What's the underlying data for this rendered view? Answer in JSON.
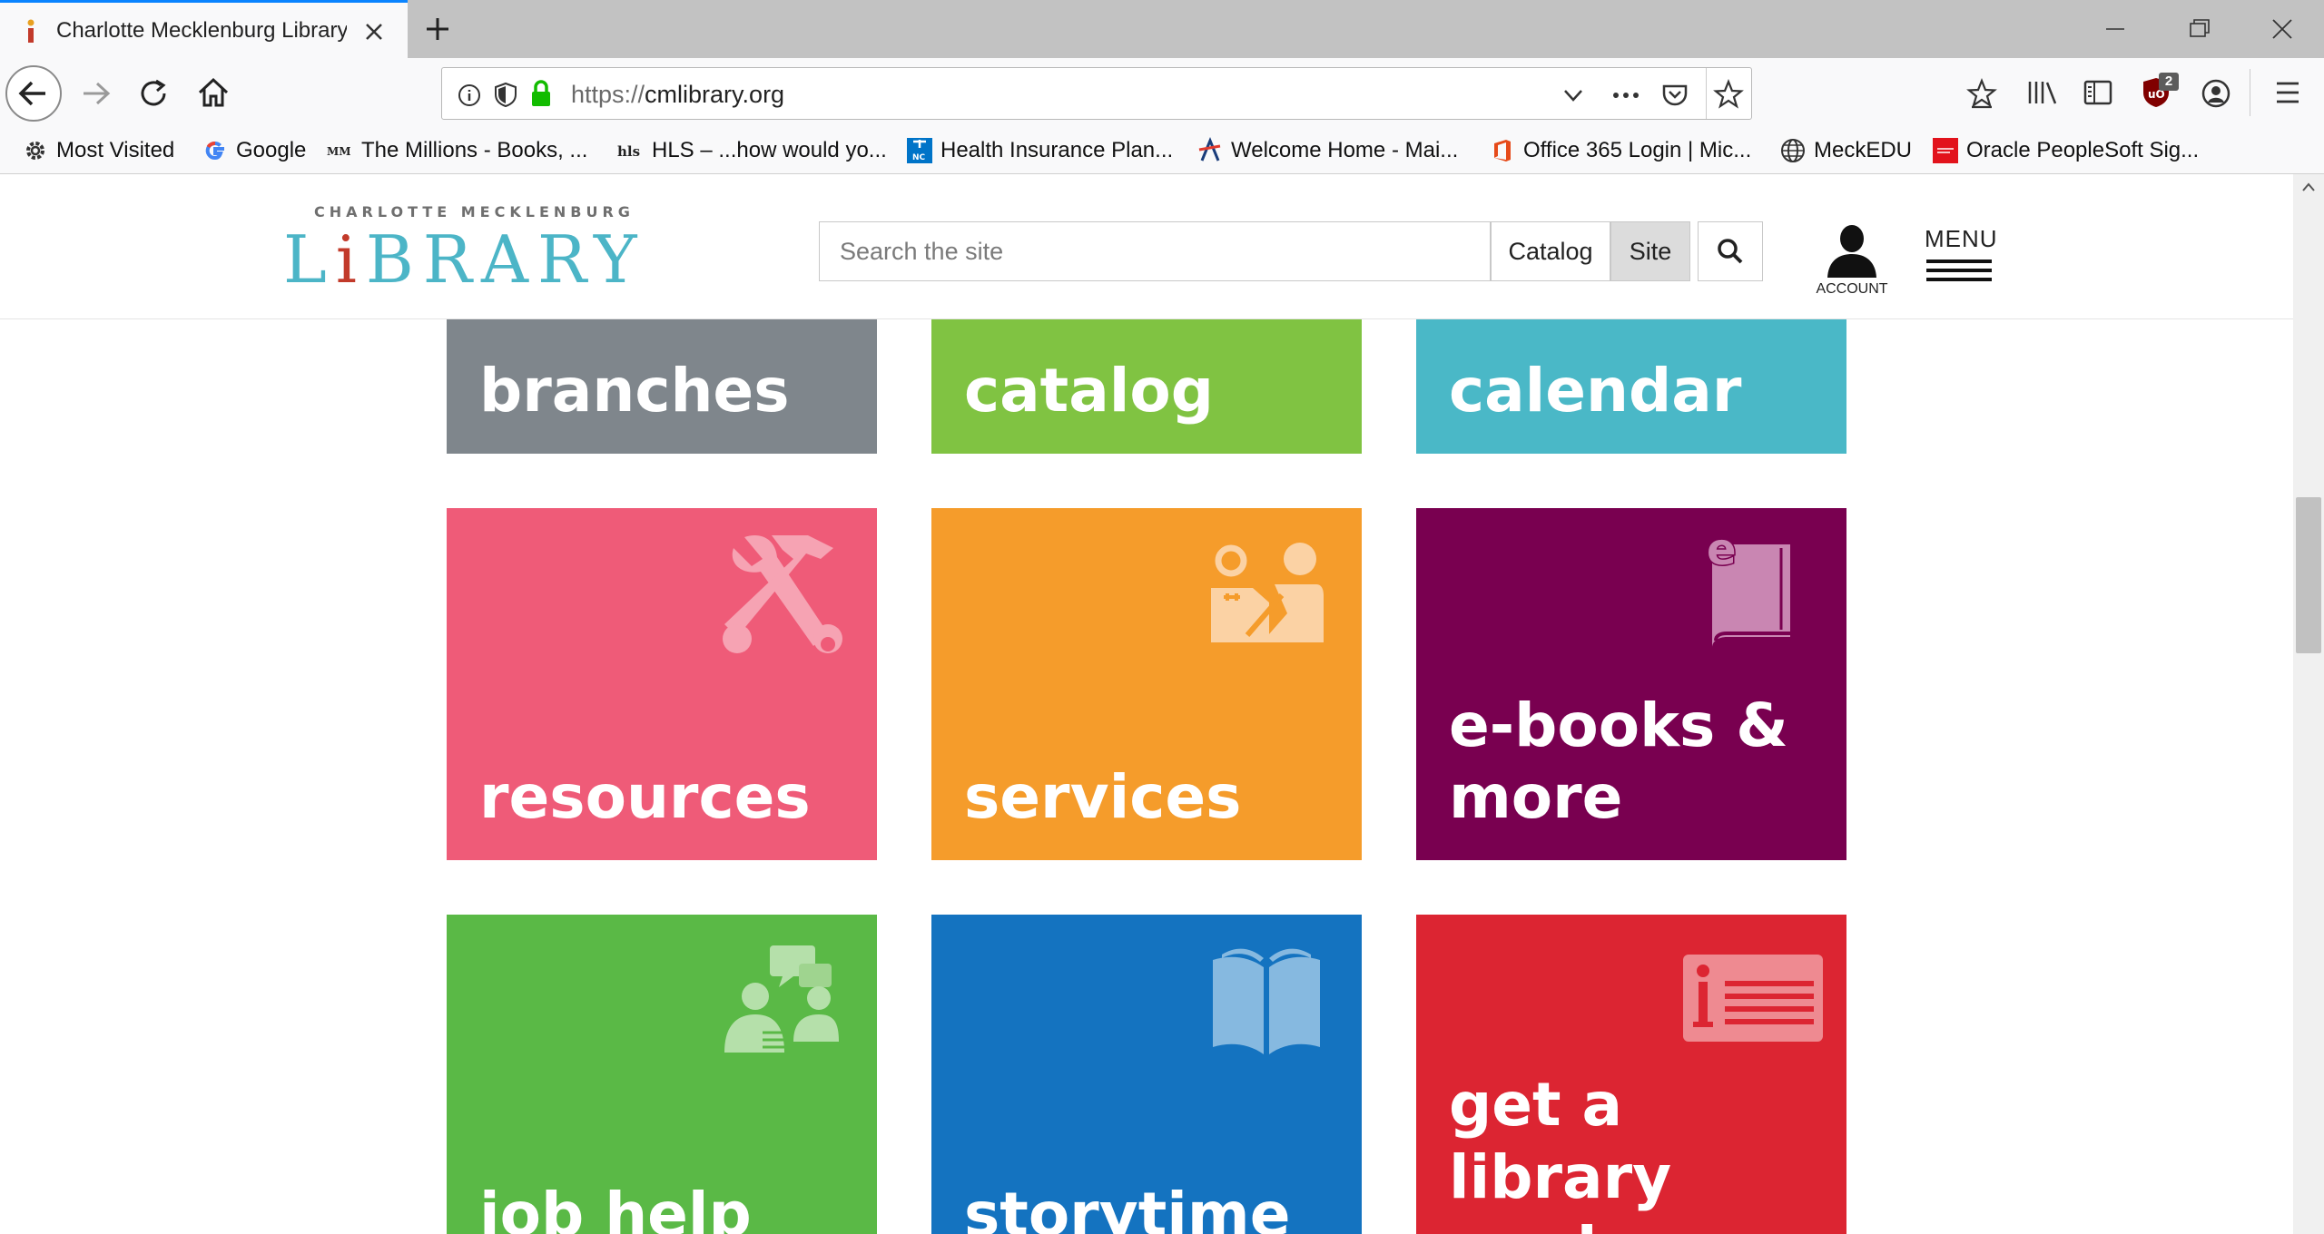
{
  "browser": {
    "tab_title": "Charlotte Mecklenburg Library",
    "url_scheme": "https://",
    "url_host": "cmlibrary.org",
    "extension_badge": "2",
    "bookmarks": [
      {
        "label": "Most Visited",
        "icon": "gear-icon"
      },
      {
        "label": "Google",
        "icon": "google-icon"
      },
      {
        "label": "The Millions - Books, ...",
        "icon": "millions-icon"
      },
      {
        "label": "HLS – ...how would yo...",
        "icon": "hls-icon"
      },
      {
        "label": "Health Insurance Plan...",
        "icon": "bcbs-icon"
      },
      {
        "label": "Welcome Home - Mai...",
        "icon": "kite-icon"
      },
      {
        "label": "Office 365 Login | Mic...",
        "icon": "office-icon"
      },
      {
        "label": "MeckEDU",
        "icon": "globe-icon"
      },
      {
        "label": "Oracle PeopleSoft Sig...",
        "icon": "oracle-icon"
      }
    ]
  },
  "site": {
    "logo_top": "CHARLOTTE MECKLENBURG",
    "logo_main_pre": "L",
    "logo_main_i": "i",
    "logo_main_post": "BRARY",
    "search_placeholder": "Search the site",
    "catalog_label": "Catalog",
    "site_label": "Site",
    "account_label": "ACCOUNT",
    "menu_label": "MENU"
  },
  "tiles": [
    {
      "label": "branches",
      "color": "#7f868c",
      "icon": "none"
    },
    {
      "label": "catalog",
      "color": "#80c342",
      "icon": "none"
    },
    {
      "label": "calendar",
      "color": "#4ab8c7",
      "icon": "none"
    },
    {
      "label": "resources",
      "color": "#ef5b78",
      "icon": "tools-icon"
    },
    {
      "label": "services",
      "color": "#f59c2b",
      "icon": "people-desk-icon"
    },
    {
      "label": "e-books & more",
      "color": "#790050",
      "icon": "ebook-icon"
    },
    {
      "label": "job help",
      "color": "#5ab946",
      "icon": "chat-people-icon"
    },
    {
      "label": "storytime",
      "color": "#1473c0",
      "icon": "open-book-icon"
    },
    {
      "label": "get a library card",
      "color": "#dc2532",
      "icon": "library-card-icon"
    }
  ]
}
